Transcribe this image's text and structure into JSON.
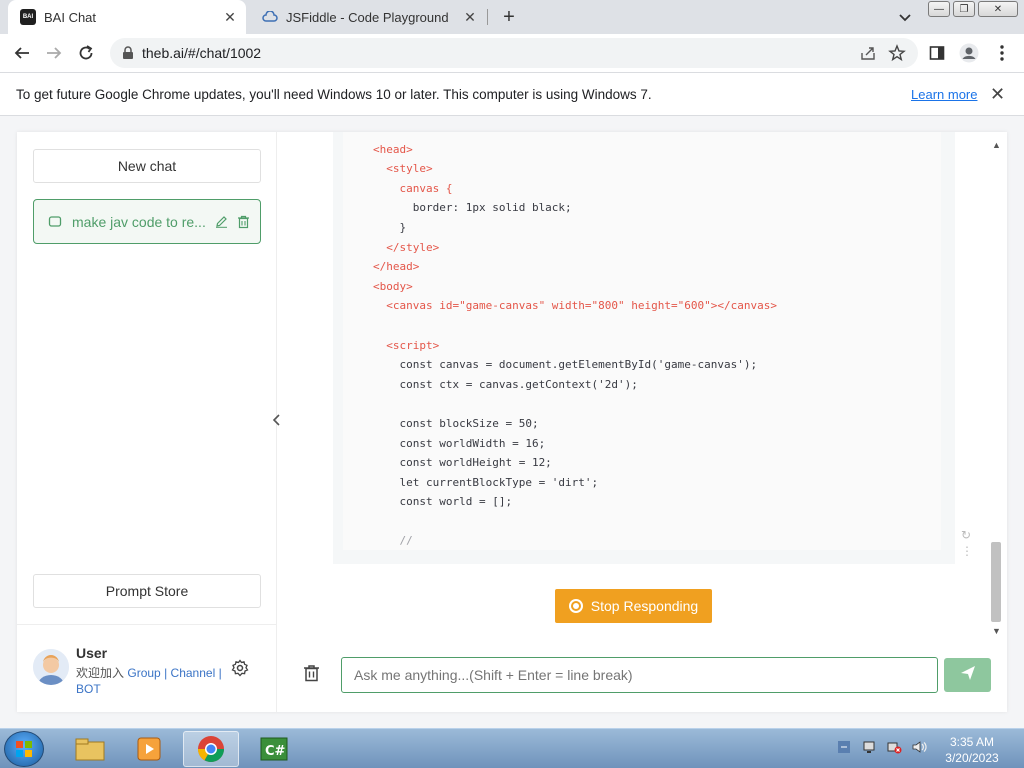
{
  "browser": {
    "tabs": [
      {
        "title": "BAI Chat",
        "favicon": "BAI"
      },
      {
        "title": "JSFiddle - Code Playground"
      }
    ],
    "url": "theb.ai/#/chat/1002",
    "infobar": {
      "message": "To get future Google Chrome updates, you'll need Windows 10 or later. This computer is using Windows 7.",
      "learn_more": "Learn more"
    }
  },
  "sidebar": {
    "new_chat": "New chat",
    "chat_item": "make jav code to re...",
    "prompt_store": "Prompt Store",
    "user": {
      "name": "User",
      "welcome": "欢迎加入",
      "link_group": "Group",
      "link_channel": "Channel",
      "link_bot": "BOT",
      "sep": "|"
    }
  },
  "chat": {
    "code_lines": [
      "<head>",
      "  <style>",
      "    canvas {",
      "      border: 1px solid black;",
      "    }",
      "  </style>",
      "</head>",
      "<body>",
      "  <canvas id=\"game-canvas\" width=\"800\" height=\"600\"></canvas>",
      "",
      "  <script>",
      "    const canvas = document.getElementById('game-canvas');",
      "    const ctx = canvas.getContext('2d');",
      "",
      "    const blockSize = 50;",
      "    const worldWidth = 16;",
      "    const worldHeight = 12;",
      "    let currentBlockType = 'dirt';",
      "    const world = [];",
      "",
      "    //"
    ],
    "stop_button": "Stop Responding",
    "input_placeholder": "Ask me anything...(Shift + Enter = line break)"
  },
  "taskbar": {
    "time": "3:35 AM",
    "date": "3/20/2023",
    "apps": [
      "explorer",
      "media-player",
      "chrome",
      "csharp"
    ],
    "csharp_label": "C#"
  },
  "colors": {
    "accent_green": "#4f9d69",
    "stop_orange": "#f0a020",
    "send_green": "#8ec79e"
  }
}
